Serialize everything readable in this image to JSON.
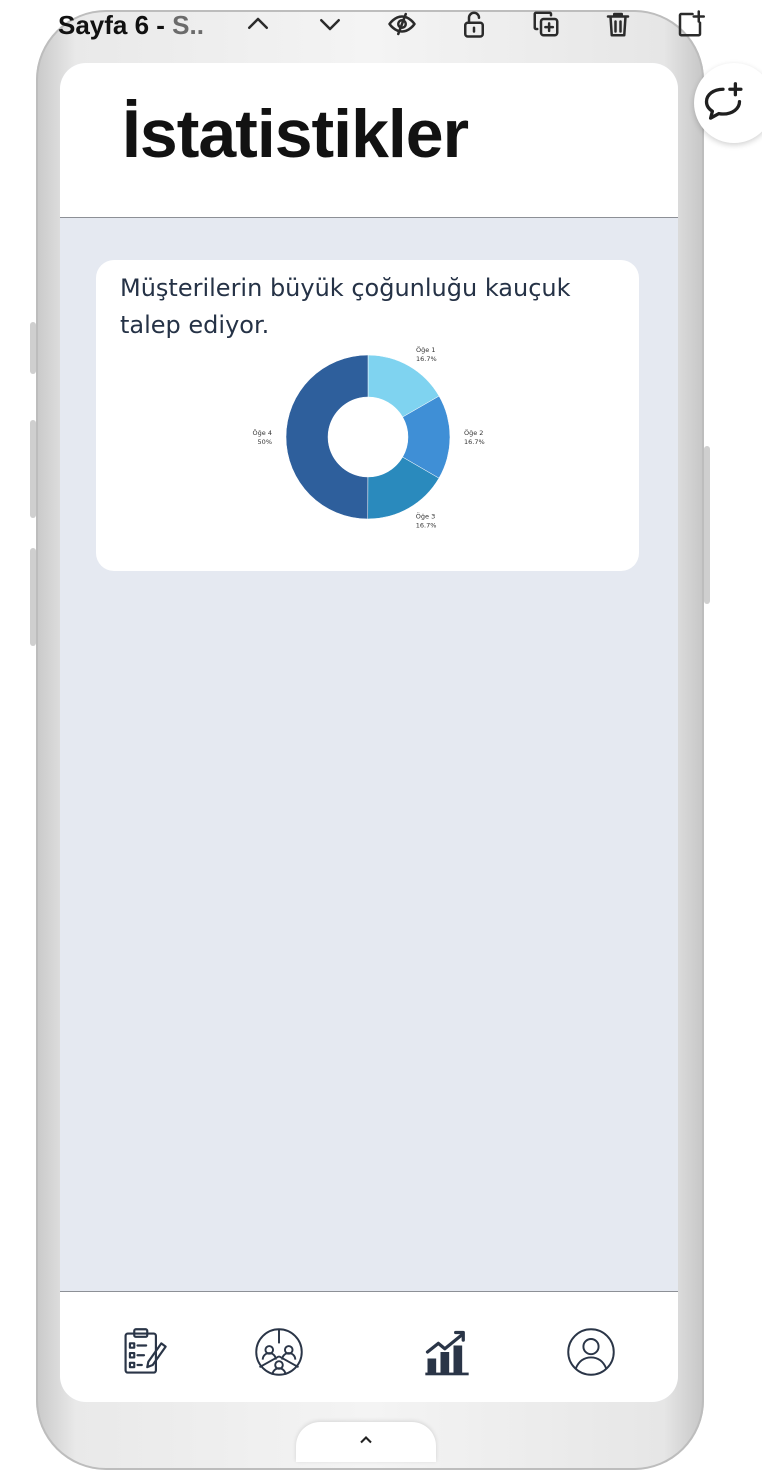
{
  "toolbar": {
    "page_title": "Sayfa 6 - ",
    "page_subtitle": "S..",
    "icons": [
      "chevron-up-icon",
      "chevron-down-icon",
      "hide-eye-icon",
      "unlock-icon",
      "duplicate-icon",
      "trash-icon",
      "add-page-icon"
    ]
  },
  "screen": {
    "title": "İstatistikler",
    "card": {
      "text": "Müşterilerin büyük çoğunluğu kauçuk talep ediyor."
    }
  },
  "chart_data": {
    "type": "pie",
    "donut": true,
    "categories": [
      "Öğe 1",
      "Öğe 2",
      "Öğe 3",
      "Öğe 4"
    ],
    "values": [
      16.7,
      16.7,
      16.7,
      50
    ],
    "value_labels": [
      "16.7%",
      "16.7%",
      "16.7%",
      "50%"
    ],
    "colors": [
      "#7fd3f0",
      "#3f8fd6",
      "#2a8abd",
      "#2e5f9c"
    ]
  },
  "bottom_nav": {
    "items": [
      "clipboard-edit-icon",
      "team-icon",
      "chart-icon",
      "profile-icon"
    ],
    "active": "chart-icon"
  },
  "colors": {
    "screen_bg": "#e5e9f1",
    "text_dark": "#253246",
    "nav_icon": "#2a3547"
  }
}
